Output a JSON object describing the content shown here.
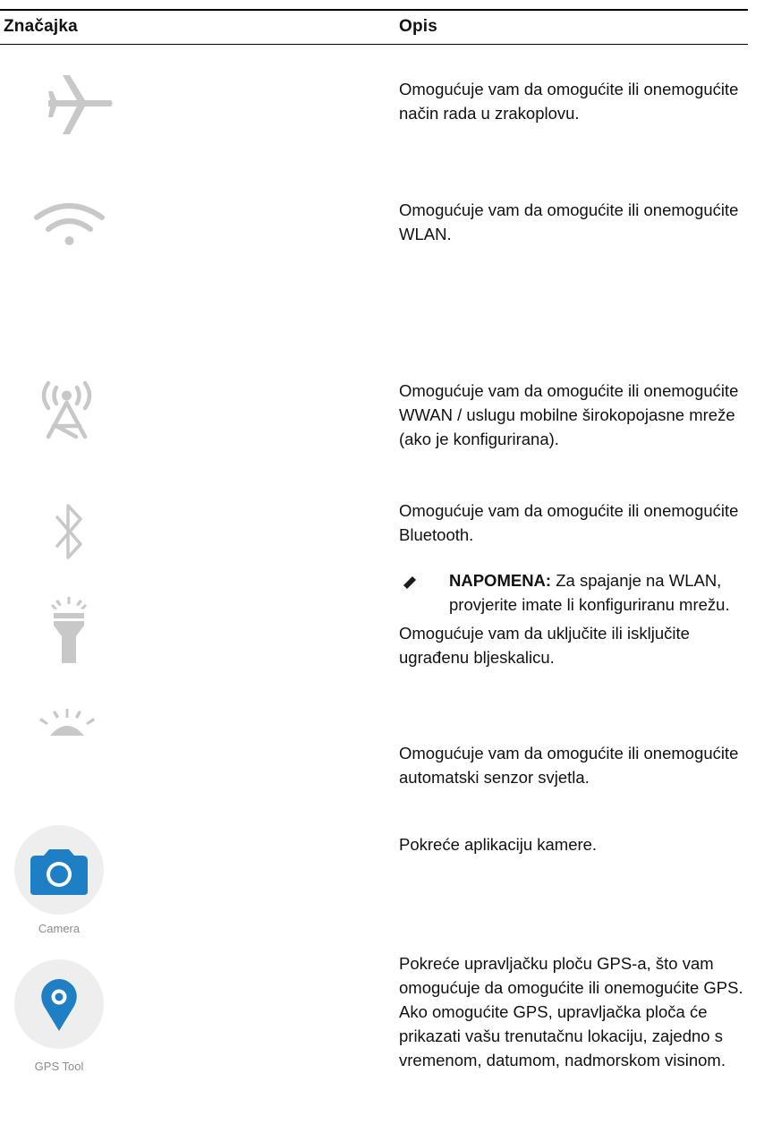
{
  "table": {
    "header": {
      "feature": "Značajka",
      "description": "Opis"
    },
    "rows": [
      {
        "icon": "airplane-icon",
        "description": "Omogućuje vam da omogućite ili onemogućite način rada u zrakoplovu."
      },
      {
        "icon": "wifi-icon",
        "description": "Omogućuje vam da omogućite ili onemogućite WLAN.",
        "note": {
          "label": "NAPOMENA:",
          "text": "Za spajanje na WLAN, provjerite imate li konfiguriranu mrežu."
        }
      },
      {
        "icon": "cellular-tower-icon",
        "description": "Omogućuje vam da omogućite ili onemogućite WWAN / uslugu mobilne širokopojasne mreže (ako je konfigurirana)."
      },
      {
        "icon": "bluetooth-icon",
        "description": "Omogućuje vam da omogućite ili onemogućite Bluetooth."
      },
      {
        "icon": "flashlight-icon",
        "description": "Omogućuje vam da uključite ili isključite ugrađenu bljeskalicu."
      },
      {
        "icon": "light-sensor-icon",
        "description": "Omogućuje vam da omogućite ili onemogućite automatski senzor svjetla."
      },
      {
        "icon": "camera-icon",
        "app_label": "Camera",
        "description": "Pokreće aplikaciju kamere."
      },
      {
        "icon": "gps-pin-icon",
        "app_label": "GPS Tool",
        "description": "Pokreće upravljačku ploču GPS-a, što vam omogućuje da omogućite ili onemogućite GPS. Ako omogućite GPS, upravljačka ploča će prikazati vašu trenutačnu lokaciju, zajedno s vremenom, datumom, nadmorskom visinom."
      }
    ]
  },
  "colors": {
    "icon_gray": "#c8c8c8",
    "accent_blue": "#1e7fc4",
    "app_bg": "#eeeeee"
  }
}
